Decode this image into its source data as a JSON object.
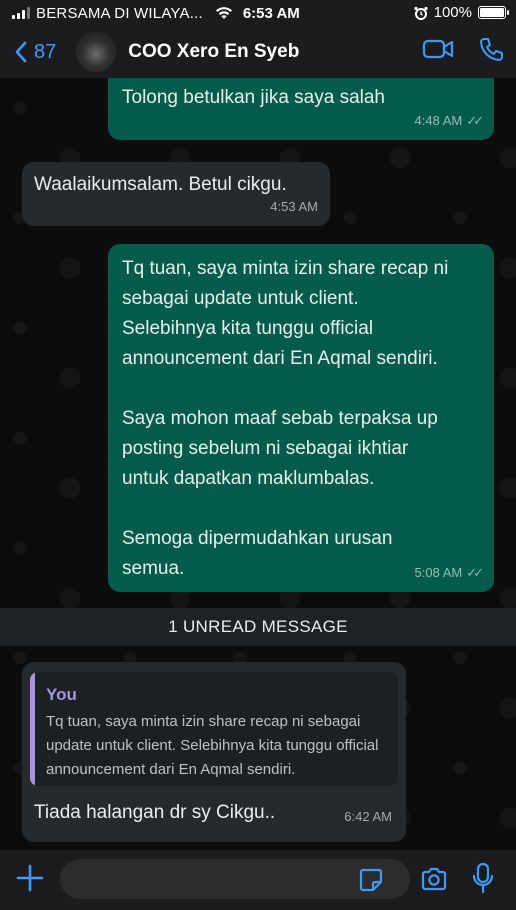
{
  "status_bar": {
    "carrier": "BERSAMA DI WILAYA...",
    "time": "6:53 AM",
    "battery": "100%",
    "battery_level": 1.0
  },
  "header": {
    "back_count": "87",
    "contact_name": "COO Xero En Syeb"
  },
  "messages": [
    {
      "direction": "outgoing",
      "text": "Tolong betulkan jika saya salah",
      "time": "4:48 AM",
      "read": true
    },
    {
      "direction": "incoming",
      "text": "Waalaikumsalam. Betul cikgu.",
      "time": "4:53 AM"
    },
    {
      "direction": "outgoing",
      "text": "Tq tuan, saya minta izin share recap ni\nsebagai update untuk client.\nSelebihnya kita tunggu official\nannouncement dari En Aqmal sendiri.\n\nSaya mohon maaf sebab terpaksa up\nposting sebelum ni sebagai ikhtiar\nuntuk dapatkan maklumbalas.\n\nSemoga dipermudahkan urusan\nsemua.",
      "time": "5:08 AM",
      "read": true
    },
    {
      "direction": "incoming",
      "text": "Tiada halangan dr sy Cikgu..",
      "time": "6:42 AM",
      "quote": {
        "author": "You",
        "text": "Tq tuan, saya minta izin share recap ni sebagai update untuk client. Selebihnya kita tunggu official announcement dari En Aqmal sendiri."
      }
    }
  ],
  "unread_divider": "1 UNREAD MESSAGE",
  "input": {
    "placeholder": "",
    "value": ""
  },
  "colors": {
    "outgoing_bubble": "#035c4b",
    "incoming_bubble": "#262a2c",
    "accent_blue": "#3b9cff",
    "quote_author": "#a693e3"
  },
  "icons": [
    "signal-icon",
    "wifi-icon",
    "alarm-icon",
    "battery-icon",
    "back-chevron-icon",
    "video-call-icon",
    "phone-icon",
    "read-ticks-icon",
    "plus-icon",
    "sticker-icon",
    "camera-icon",
    "microphone-icon"
  ]
}
